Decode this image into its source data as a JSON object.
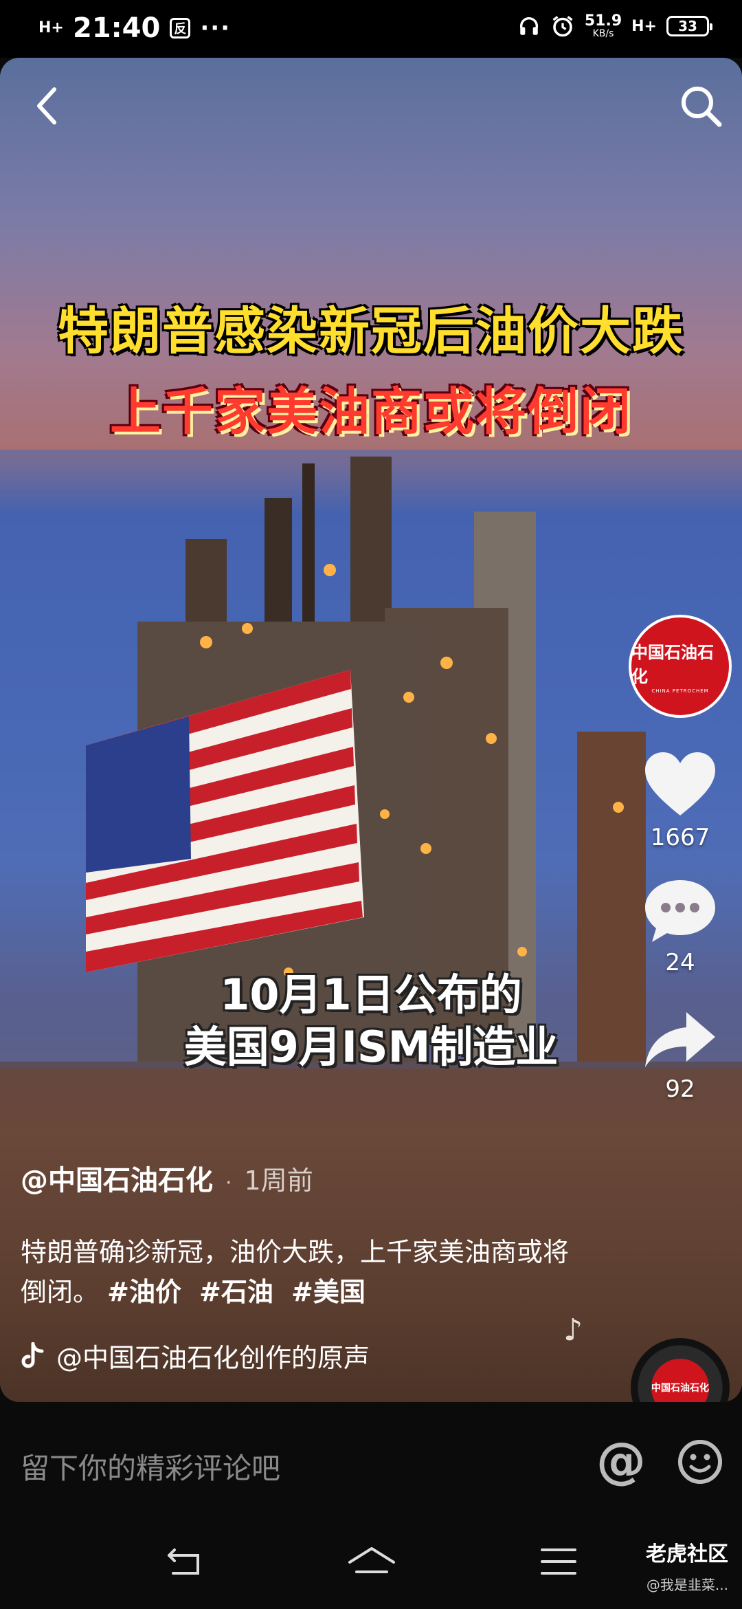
{
  "status_bar": {
    "network": "H+",
    "time": "21:40",
    "app_badge": "反",
    "more": "···",
    "speed_value": "51.9",
    "speed_unit": "KB/s",
    "signal": "H+",
    "battery": "33"
  },
  "video": {
    "headline_line1": "特朗普感染新冠后油价大跌",
    "headline_line2": "上千家美油商或将倒闭",
    "subtitle_line1": "10月1日公布的",
    "subtitle_line2": "美国9月ISM制造业"
  },
  "rail": {
    "avatar_text": "中国石油石化",
    "avatar_sub": "CHINA PETROCHEM",
    "likes": "1667",
    "comments": "24",
    "shares": "92"
  },
  "post": {
    "author": "@中国石油石化",
    "dot": "·",
    "posted": "1周前",
    "description": "特朗普确诊新冠，油价大跌，上千家美油商或将倒闭。",
    "tags": [
      "#油价",
      "#石油",
      "#美国"
    ],
    "music": "@中国石油石化创作的原声"
  },
  "disc_text": "中国石油石化",
  "comment_bar": {
    "placeholder": "留下你的精彩评论吧",
    "at": "@"
  },
  "watermark": {
    "title": "老虎社区",
    "sub": "@我是韭菜..."
  },
  "colors": {
    "headline_yellow": "#ffde2e",
    "headline_red": "#ff3a2e",
    "brand_red": "#d0141e"
  }
}
